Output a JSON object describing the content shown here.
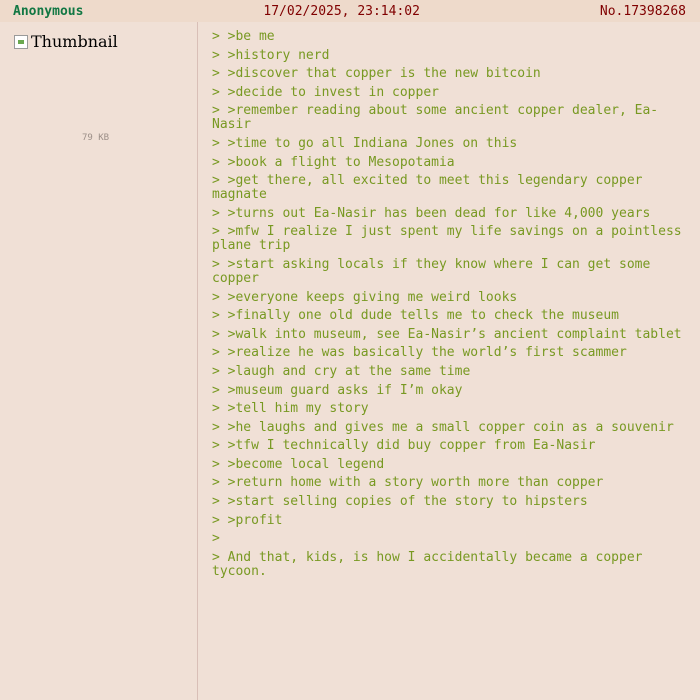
{
  "post": {
    "name": "Anonymous",
    "datetime": "17/02/2025, 23:14:02",
    "number": "No.17398268",
    "thumbnail_alt": "Thumbnail",
    "file_size": "79 KB",
    "lines": [
      "> >be me",
      "> >history nerd",
      "> >discover that copper is the new bitcoin",
      "> >decide to invest in copper",
      "> >remember reading about some ancient copper dealer, Ea-Nasir",
      "> >time to go all Indiana Jones on this",
      "> >book a flight to Mesopotamia",
      "> >get there, all excited to meet this legendary copper magnate",
      "> >turns out Ea-Nasir has been dead for like 4,000 years",
      "> >mfw I realize I just spent my life savings on a pointless plane trip",
      "> >start asking locals if they know where I can get some copper",
      "> >everyone keeps giving me weird looks",
      "> >finally one old dude tells me to check the museum",
      "> >walk into museum, see Ea-Nasir’s ancient complaint tablet",
      "> >realize he was basically the world’s first scammer",
      "> >laugh and cry at the same time",
      "> >museum guard asks if I’m okay",
      "> >tell him my story",
      "> >he laughs and gives me a small copper coin as a souvenir",
      "> >tfw I technically did buy copper from Ea-Nasir",
      "> >become local legend",
      "> >return home with a story worth more than copper",
      "> >start selling copies of the story to hipsters",
      "> >profit",
      ">",
      "> And that, kids, is how I accidentally became a copper tycoon."
    ]
  },
  "colors": {
    "background": "#f0e0d6",
    "header_background": "#eedacb",
    "name": "#117743",
    "meta": "#800000",
    "greentext": "#789922",
    "filesize": "#9c8f88"
  }
}
